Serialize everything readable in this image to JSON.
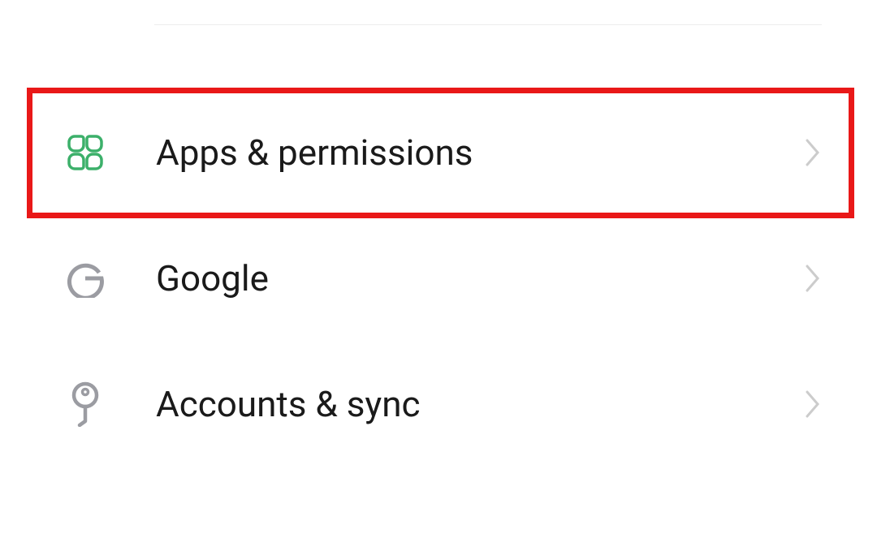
{
  "settings": {
    "items": [
      {
        "label": "Apps & permissions",
        "icon": "apps-icon",
        "iconColor": "#3cb06a",
        "highlighted": true
      },
      {
        "label": "Google",
        "icon": "google-icon",
        "iconColor": "#9b9ca2",
        "highlighted": false
      },
      {
        "label": "Accounts & sync",
        "icon": "key-icon",
        "iconColor": "#9b9ca2",
        "highlighted": false
      }
    ],
    "chevronColor": "#cccccc",
    "highlightColor": "#e91818"
  }
}
